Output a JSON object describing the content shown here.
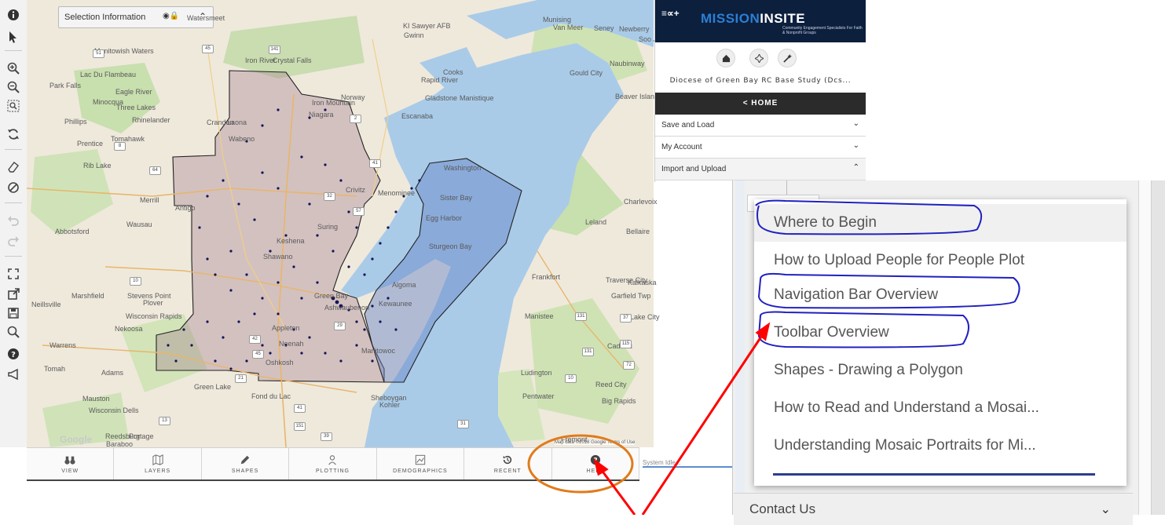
{
  "selection_info": {
    "label": "Selection Information"
  },
  "map": {
    "google_logo": "Google",
    "attribution": "Map data ©2018 Google  Terms of Use",
    "cities": [
      {
        "name": "Watersmeet"
      },
      {
        "name": "Iron River"
      },
      {
        "name": "Crystal Falls"
      },
      {
        "name": "Manitowish Waters"
      },
      {
        "name": "Lac Du Flambeau"
      },
      {
        "name": "Park Falls"
      },
      {
        "name": "Eagle River"
      },
      {
        "name": "Minocqua"
      },
      {
        "name": "Three Lakes"
      },
      {
        "name": "Phillips"
      },
      {
        "name": "Rhinelander"
      },
      {
        "name": "Iron Mountain"
      },
      {
        "name": "Norway"
      },
      {
        "name": "Niagara"
      },
      {
        "name": "Crandon"
      },
      {
        "name": "Laona"
      },
      {
        "name": "Prentice"
      },
      {
        "name": "Tomahawk"
      },
      {
        "name": "Wabeno"
      },
      {
        "name": "Rib Lake"
      },
      {
        "name": "Merrill"
      },
      {
        "name": "Antigo"
      },
      {
        "name": "Crivitz"
      },
      {
        "name": "Menominee"
      },
      {
        "name": "Escanaba"
      },
      {
        "name": "Gladstone"
      },
      {
        "name": "Rapid River"
      },
      {
        "name": "Cooks"
      },
      {
        "name": "Manistique"
      },
      {
        "name": "Washington"
      },
      {
        "name": "Sister Bay"
      },
      {
        "name": "Egg Harbor"
      },
      {
        "name": "Sturgeon Bay"
      },
      {
        "name": "Wausau"
      },
      {
        "name": "Abbotsford"
      },
      {
        "name": "Suring"
      },
      {
        "name": "Keshena"
      },
      {
        "name": "Shawano"
      },
      {
        "name": "Marshfield"
      },
      {
        "name": "Neillsville"
      },
      {
        "name": "Stevens Point"
      },
      {
        "name": "Plover"
      },
      {
        "name": "Wisconsin Rapids"
      },
      {
        "name": "Nekoosa"
      },
      {
        "name": "Green Bay"
      },
      {
        "name": "Ashwaubenon"
      },
      {
        "name": "Kewaunee"
      },
      {
        "name": "Algoma"
      },
      {
        "name": "Appleton"
      },
      {
        "name": "Neenah"
      },
      {
        "name": "Oshkosh"
      },
      {
        "name": "Manitowoc"
      },
      {
        "name": "Warrens"
      },
      {
        "name": "Tomah"
      },
      {
        "name": "Adams"
      },
      {
        "name": "Mauston"
      },
      {
        "name": "Wisconsin Dells"
      },
      {
        "name": "Reedsburg"
      },
      {
        "name": "Portage"
      },
      {
        "name": "Baraboo"
      },
      {
        "name": "Green Lake"
      },
      {
        "name": "Fond du Lac"
      },
      {
        "name": "Sheboygan"
      },
      {
        "name": "Kohler"
      },
      {
        "name": "Ludington"
      },
      {
        "name": "Pentwater"
      },
      {
        "name": "Fremont"
      },
      {
        "name": "Big Rapids"
      },
      {
        "name": "Reed City"
      },
      {
        "name": "Cadillac"
      },
      {
        "name": "Manistee"
      },
      {
        "name": "Frankfort"
      },
      {
        "name": "Traverse City"
      },
      {
        "name": "Garfield Twp"
      },
      {
        "name": "Kalkaska"
      },
      {
        "name": "Leland"
      },
      {
        "name": "Charlevoix"
      },
      {
        "name": "Bellaire"
      },
      {
        "name": "Beaver Island"
      },
      {
        "name": "Gould City"
      },
      {
        "name": "Naubinway"
      },
      {
        "name": "Munising"
      },
      {
        "name": "Van Meer"
      },
      {
        "name": "Seney"
      },
      {
        "name": "Newberry"
      },
      {
        "name": "Soo Junction"
      },
      {
        "name": "KI Sawyer AFB"
      },
      {
        "name": "Gwinn"
      },
      {
        "name": "Lake City"
      }
    ],
    "shields": [
      "51",
      "45",
      "141",
      "2",
      "8",
      "32",
      "64",
      "41",
      "57",
      "10",
      "29",
      "42",
      "45",
      "21",
      "13",
      "41",
      "151",
      "39",
      "31",
      "10",
      "131",
      "131",
      "31",
      "37",
      "72",
      "115"
    ]
  },
  "bottom_nav": [
    {
      "label": "VIEW",
      "icon": "binoculars-icon"
    },
    {
      "label": "LAYERS",
      "icon": "map-layers-icon"
    },
    {
      "label": "SHAPES",
      "icon": "pencil-icon"
    },
    {
      "label": "PLOTTING",
      "icon": "person-pin-icon"
    },
    {
      "label": "DEMOGRAPHICS",
      "icon": "image-chart-icon"
    },
    {
      "label": "RECENT",
      "icon": "history-icon"
    },
    {
      "label": "HELP",
      "icon": "question-circle-icon"
    }
  ],
  "status": {
    "text": "System Idle..."
  },
  "panel": {
    "brand_prefix": "MISSION",
    "brand_main": "INSITE",
    "tagline": "Community Engagement Specialists For Faith & Nonprofit Groups",
    "header_icons": "≡∝+",
    "study_name": "Diocese of Green Bay RC Base Study (Dcs...",
    "home_label": "< HOME",
    "accordion": [
      {
        "label": "Save and Load",
        "caret": "⌄"
      },
      {
        "label": "My Account",
        "caret": "⌄"
      },
      {
        "label": "Import and Upload",
        "caret": "⌃"
      }
    ]
  },
  "help_menu": {
    "items": [
      "Where to Begin",
      "How to Upload People for People Plot",
      "Navigation Bar Overview",
      "Toolbar Overview",
      "Shapes - Drawing a Polygon",
      "How to Read and Understand a Mosai...",
      "Understanding Mosaic Portraits for Mi..."
    ],
    "contact_label": "Contact Us"
  },
  "colors": {
    "annotation_red": "#ff0000",
    "annotation_orange": "#e07b1c",
    "circle_blue": "#2020c0",
    "panel_dark": "#0c1f3d"
  }
}
